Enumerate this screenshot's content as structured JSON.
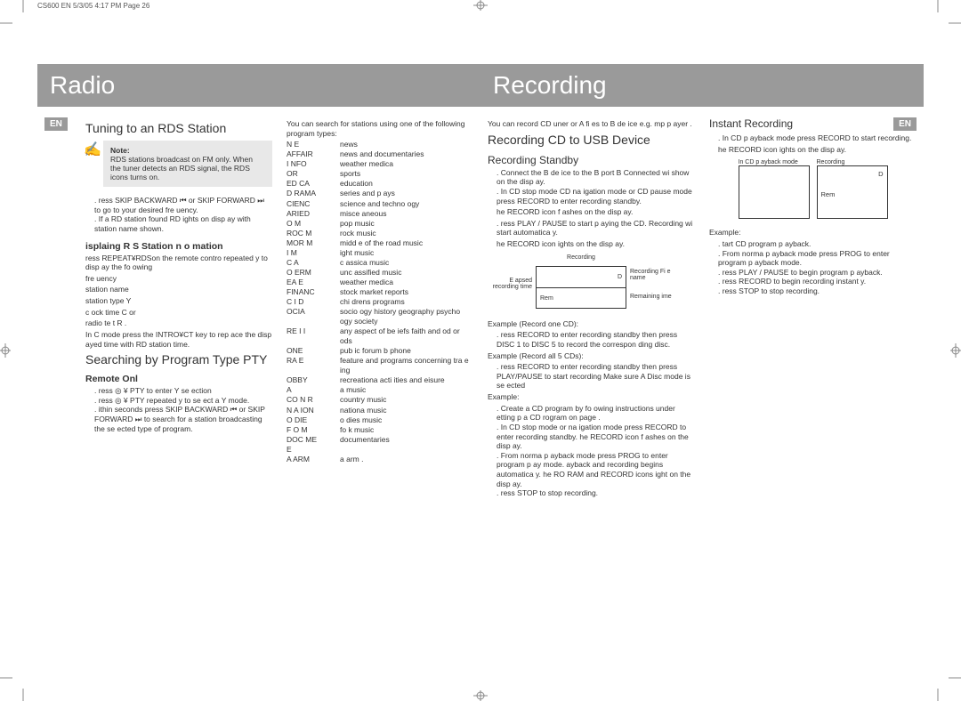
{
  "header": "CS600 EN  5/3/05  4:17 PM  Page 26",
  "lang_badge": "EN",
  "left_title": "Radio",
  "right_title": "Recording",
  "radio": {
    "tuning_heading": "Tuning to an RDS Station",
    "note_label": "Note:",
    "note_body": "RDS stations broadcast on FM only. When the tuner detects an RDS signal, the RDS icons turns on.",
    "step1": "ress SKIP BACKWARD ⏮ or SKIP FORWARD ⏭ to go to your desired fre uency.",
    "step2": "If a RD  station found RD  ights on disp ay with station name shown.",
    "display_heading": "isplaing R S Station n o mation",
    "display_intro": "ress REPEAT¥RDSon the remote contro repeated y to disp ay the fo owing",
    "display_list": [
      "fre uency",
      "station name",
      "station type   Y",
      "c ock time  C   or",
      "radio te t  R   ."
    ],
    "display_note": "In C  mode  press the INTRO¥CT key to rep ace the disp ayed time with RD  station time.",
    "pty_heading": "Searching by Program Type PTY",
    "remote_only": "Remote Onl",
    "pty_step1": "ress  ◎ ¥ PTY to enter    Y se ection",
    "pty_step2": "ress  ◎ ¥ PTY repeated y to se ect a   Y mode.",
    "pty_step3": "ithin  seconds  press SKIP BACKWARD ⏮ or SKIP FORWARD ⏭ to search for a station broadcasting the se ected type of program.",
    "pty_intro": "You can search for stations using one of the following program types:",
    "pty": [
      [
        "N E",
        "news"
      ],
      [
        "AFFAIR",
        "news and documentaries"
      ],
      [
        "I NFO",
        "weather  medica"
      ],
      [
        "  OR",
        "sports"
      ],
      [
        "ED  CA",
        "education"
      ],
      [
        "D RAMA",
        "series and p ays"
      ],
      [
        "  CIENC",
        "science and techno ogy"
      ],
      [
        "  ARIED",
        "misce aneous"
      ],
      [
        "  O  M",
        "pop music"
      ],
      [
        "ROC  M",
        "rock music"
      ],
      [
        "MOR M",
        "midd e of the road music"
      ],
      [
        "  I   M",
        "ight music"
      ],
      [
        "C  A",
        "c assica music"
      ],
      [
        "O   ERM",
        "unc assified music"
      ],
      [
        "  EA   E",
        "weather  medica"
      ],
      [
        "FINANC",
        "stock market reports"
      ],
      [
        "C  I  D",
        "chi drens programs"
      ],
      [
        "  OCIA",
        "socio ogy  history  geography  psycho ogy  society"
      ],
      [
        "RE  I  I",
        "any aspect of be iefs  faith  and  od or ods"
      ],
      [
        "  ONE",
        "pub ic forum b phone"
      ],
      [
        "  RA  E",
        "feature and programs concerning tra e ing"
      ],
      [
        "  OBBY",
        "recreationa  acti ities and eisure"
      ],
      [
        "  A",
        "a music"
      ],
      [
        "CO  N R",
        "country music"
      ],
      [
        "N A  ION",
        "nationa  music"
      ],
      [
        "O  DIE",
        "o dies music"
      ],
      [
        "F O   M",
        "fo k music"
      ],
      [
        "DOC  ME",
        "documentaries"
      ],
      [
        "  E",
        ""
      ],
      [
        "A ARM",
        "a arm ."
      ]
    ]
  },
  "rec": {
    "intro": "You can record CD   uner or A     fi es to   B de ice  e.g. mp  p ayer .",
    "cd_usb_heading": "Recording CD to USB Device",
    "standby_heading": "Recording Standby",
    "standby1": "Connect the   B de ice to the   B port    B Connected wi  show on the disp ay.",
    "standby2": "In CD stop mode  CD na igation mode or CD pause mode  press RECORD to enter recording standby.",
    "standby2b": "he RECORD icon f ashes on the disp ay.",
    "standby3": "ress PLAY / PAUSE to start p aying the CD. Recording wi  start automatica y.",
    "standby3b": "he RECORD icon ights on the disp ay.",
    "diag_recording": "Recording",
    "diag_d": "D",
    "diag_rem": "Rem",
    "diag_elapsed": "E apsed recording time",
    "diag_filename": "Recording Fi e name",
    "diag_remaining": "Remaining ime",
    "ex1_label": "Example (Record one CD):",
    "ex1": "ress RECORD to enter recording standby  then press DISC 1 to DISC 5 to record the correspon ding disc.",
    "ex2_label": "Example (Record all 5 CDs):",
    "ex2": "ress RECORD to enter recording standby  then press PLAY/PAUSE to start recording  Make sure A  Disc mode is se ected",
    "ex3_label": "Example:",
    "ex3a": "Create a CD program by fo owing instructions under  etting   p a CD  rogram on page    .",
    "ex3b": "In CD stop mode or na igation mode  press RECORD to enter recording standby.  he RECORD icon f ashes on the disp ay.",
    "ex3c": "From norma  p ayback mode  press PROG to enter program p ay mode.  ayback and recording begins automatica y.  he  RO RAM and RECORD icons  ight on the disp ay.",
    "ex3d": "ress STOP to stop recording.",
    "instant_heading": "Instant Recording",
    "instant1": "In CD p ayback mode  press RECORD to start recording.",
    "instant1b": "he RECORD icon ights on the disp ay.",
    "box1_label": "In CD p ayback mode",
    "box2_label": "Recording",
    "ex_label": "Example:",
    "exa": "tart CD program p ayback.",
    "exb": "From norma  p ayback mode  press PROG to enter program p ayback mode.",
    "exc": "ress PLAY / PAUSE to begin program p ayback.",
    "exd": "ress RECORD to begin recording instant y.",
    "exe": "ress STOP to stop recording."
  }
}
